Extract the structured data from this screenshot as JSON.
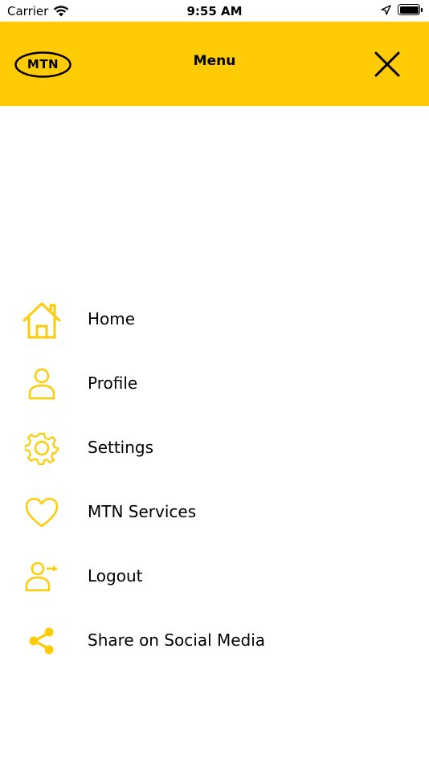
{
  "status_bar": {
    "carrier": "Carrier",
    "time": "9:55 AM"
  },
  "header": {
    "logo_text": "MTN",
    "title": "Menu",
    "close_icon": "close-icon"
  },
  "menu": {
    "items": [
      {
        "label": "Home",
        "icon": "home-icon"
      },
      {
        "label": "Profile",
        "icon": "user-icon"
      },
      {
        "label": "Settings",
        "icon": "gear-icon"
      },
      {
        "label": "MTN Services",
        "icon": "heart-icon"
      },
      {
        "label": "Logout",
        "icon": "logout-icon"
      },
      {
        "label": "Share on Social Media",
        "icon": "share-icon"
      }
    ]
  },
  "colors": {
    "brand_yellow": "#ffcb05",
    "icon_yellow": "#ffcb05",
    "text": "#000000"
  }
}
